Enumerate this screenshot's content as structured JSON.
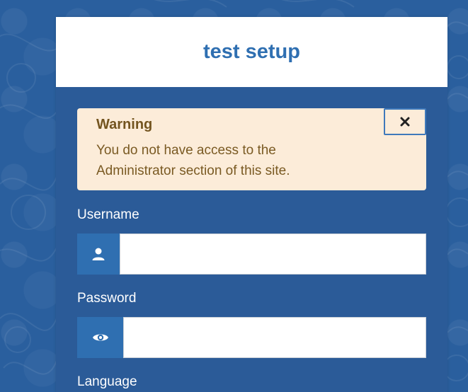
{
  "login": {
    "title": "test setup",
    "alert": {
      "heading": "Warning",
      "message": "You do not have access to the Administrator section of this site.",
      "close_icon": "close-icon"
    },
    "fields": {
      "username": {
        "label": "Username",
        "value": "",
        "icon": "user-icon"
      },
      "password": {
        "label": "Password",
        "value": "",
        "icon": "eye-icon"
      },
      "language": {
        "label": "Language"
      }
    }
  },
  "colors": {
    "page_background": "#2a5f9e",
    "card_background": "#2b5b98",
    "title_text": "#2f6fb1",
    "alert_background": "#fcecd9",
    "alert_text": "#7a5a23",
    "addon_background": "#2f6fb1"
  }
}
